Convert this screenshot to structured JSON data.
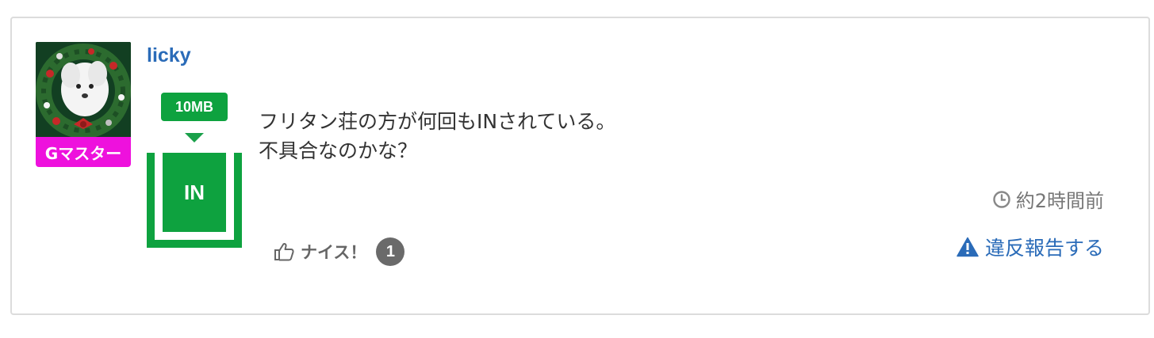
{
  "post": {
    "username": "licky",
    "rank": "Gマスター",
    "data_size": "10MB",
    "status": "IN",
    "gauge_level": 0.85,
    "message_lines": [
      "フリタン荘の方が何回もINされている。",
      "不具合なのかな？"
    ],
    "timestamp": "約2時間前",
    "report_label": "違反報告する",
    "nice_label": "ナイス！",
    "nice_count": "1"
  },
  "colors": {
    "link": "#2a6bb8",
    "green": "#0ea23f",
    "rank_badge": "#ee11dd",
    "muted": "#777777"
  },
  "icons": {
    "avatar": "dog-in-christmas-wreath-image",
    "time": "clock-icon",
    "report": "warning-icon",
    "nice": "thumbs-up-icon"
  }
}
